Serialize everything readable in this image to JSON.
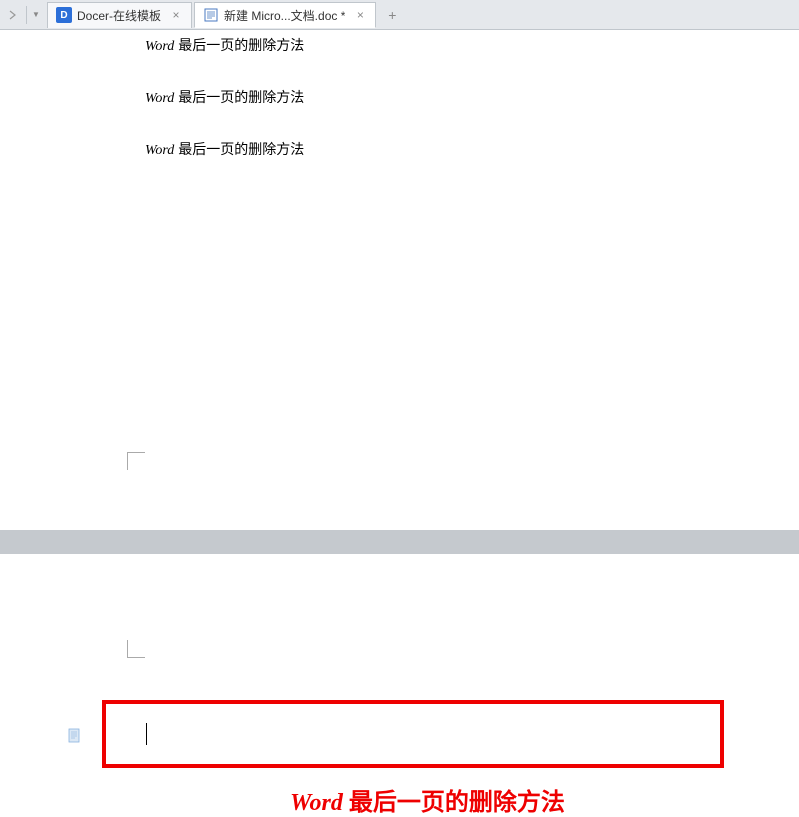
{
  "tabs": [
    {
      "label": "Docer-在线模板",
      "icon": "D"
    },
    {
      "label": "新建 Micro...文档.doc *",
      "icon": "W"
    }
  ],
  "document": {
    "lines": [
      {
        "word": "Word",
        "rest": " 最后一页的删除方法"
      },
      {
        "word": "Word",
        "rest": " 最后一页的删除方法"
      },
      {
        "word": "Word",
        "rest": " 最后一页的删除方法"
      }
    ]
  },
  "annotation": {
    "word": "Word",
    "rest": " 最后一页的删除方法"
  }
}
